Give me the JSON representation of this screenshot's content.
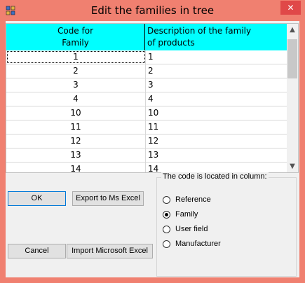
{
  "window": {
    "title": "Edit the families in tree",
    "close_glyph": "✕"
  },
  "grid": {
    "columns": [
      {
        "line1": "Code for",
        "line2": "Family"
      },
      {
        "line1": "Description of the family",
        "line2": "of products"
      }
    ],
    "rows": [
      {
        "code": "1",
        "desc": "1"
      },
      {
        "code": "2",
        "desc": "2"
      },
      {
        "code": "3",
        "desc": "3"
      },
      {
        "code": "4",
        "desc": "4"
      },
      {
        "code": "10",
        "desc": "10"
      },
      {
        "code": "11",
        "desc": "11"
      },
      {
        "code": "12",
        "desc": "12"
      },
      {
        "code": "13",
        "desc": "13"
      },
      {
        "code": "14",
        "desc": "14"
      }
    ],
    "header_color": "#00ffff"
  },
  "buttons": {
    "ok": "OK",
    "export": "Export to Ms Excel",
    "cancel": "Cancel",
    "import": "Import Microsoft Excel"
  },
  "code_location": {
    "legend": "The code is located in column:",
    "options": [
      "Reference",
      "Family",
      "User field",
      "Manufacturer"
    ],
    "selected": "Family"
  },
  "colors": {
    "window_frame": "#f08070",
    "close_button": "#e04848"
  }
}
